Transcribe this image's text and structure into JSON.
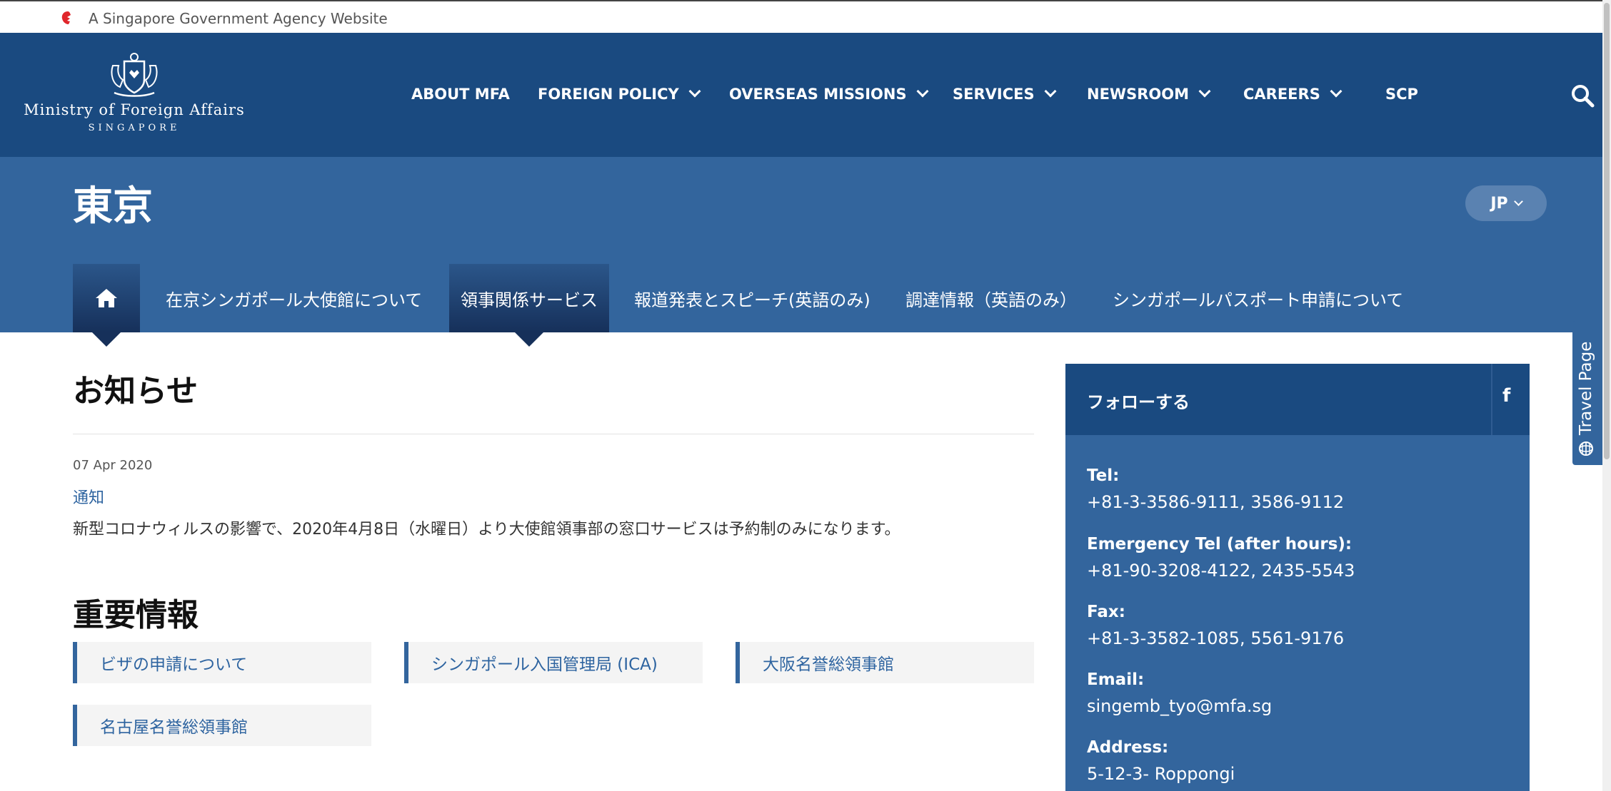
{
  "masthead": {
    "text": "A Singapore Government Agency Website"
  },
  "header": {
    "logo_name": "Ministry of Foreign Affairs",
    "logo_sub": "SINGAPORE",
    "nav": [
      {
        "label": "ABOUT MFA",
        "has_dropdown": false
      },
      {
        "label": "FOREIGN POLICY",
        "has_dropdown": true
      },
      {
        "label": "OVERSEAS MISSIONS",
        "has_dropdown": true
      },
      {
        "label": "SERVICES",
        "has_dropdown": true
      },
      {
        "label": "NEWSROOM",
        "has_dropdown": true
      },
      {
        "label": "CAREERS",
        "has_dropdown": true
      },
      {
        "label": "SCP",
        "has_dropdown": false
      }
    ]
  },
  "band": {
    "title": "東京",
    "language": "JP",
    "subnav": [
      {
        "label": "在京シンガポール大使館について"
      },
      {
        "label": "領事関係サービス"
      },
      {
        "label": "報道発表とスピーチ(英語のみ)"
      },
      {
        "label": "調達情報（英語のみ）"
      },
      {
        "label": "シンガポールパスポート申請について"
      }
    ]
  },
  "notices": {
    "title": "お知らせ",
    "date": "07 Apr 2020",
    "category": "通知",
    "text": "新型コロナウィルスの影響で、2020年4月8日（水曜日）より大使館領事部の窓口サービスは予約制のみになります。"
  },
  "important": {
    "title": "重要情報",
    "links": [
      "ビザの申請について",
      "シンガポール入国管理局 (ICA)",
      "大阪名誉総領事館",
      "名古屋名誉総領事館"
    ]
  },
  "sidebar": {
    "follow": "フォローする",
    "fb": "f",
    "contacts": [
      {
        "label": "Tel:",
        "value": "+81-3-3586-9111, 3586-9112"
      },
      {
        "label": "Emergency Tel (after hours):",
        "value": "+81-90-3208-4122, 2435-5543"
      },
      {
        "label": "Fax:",
        "value": "+81-3-3582-1085, 5561-9176"
      },
      {
        "label": "Email:",
        "value": "singemb_tyo@mfa.sg"
      },
      {
        "label": "Address:",
        "value": "5-12-3- Roppongi"
      }
    ]
  },
  "travel_tab": {
    "label": "Travel Page"
  },
  "colors": {
    "navy": "#1a4a80",
    "band": "#33659d",
    "link": "#2e64a0"
  }
}
